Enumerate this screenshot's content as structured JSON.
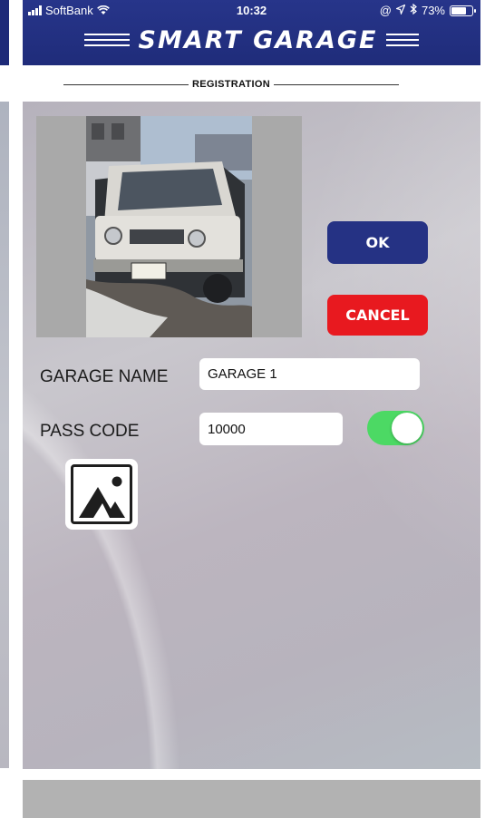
{
  "status": {
    "carrier": "SoftBank",
    "time": "10:32",
    "battery": "73%",
    "battery_level": 0.73,
    "status_icons": [
      "signal-icon",
      "wifi-icon",
      "at-icon",
      "location-icon",
      "bluetooth-icon",
      "battery-icon"
    ]
  },
  "header": {
    "title": "SMART GARAGE"
  },
  "page": {
    "section_label": "REGISTRATION"
  },
  "buttons": {
    "ok_label": "OK",
    "cancel_label": "CANCEL"
  },
  "form": {
    "garage_name_label": "GARAGE NAME",
    "garage_name_value": "GARAGE 1",
    "pass_code_label": "PASS CODE",
    "pass_code_value": "10000",
    "pass_code_toggle_on": true
  },
  "colors": {
    "header_bg": "#22307f",
    "ok_button": "#253284",
    "cancel_button": "#e8191f",
    "toggle_on": "#4cd964"
  },
  "icons": {
    "photo_picker": "image-icon"
  }
}
